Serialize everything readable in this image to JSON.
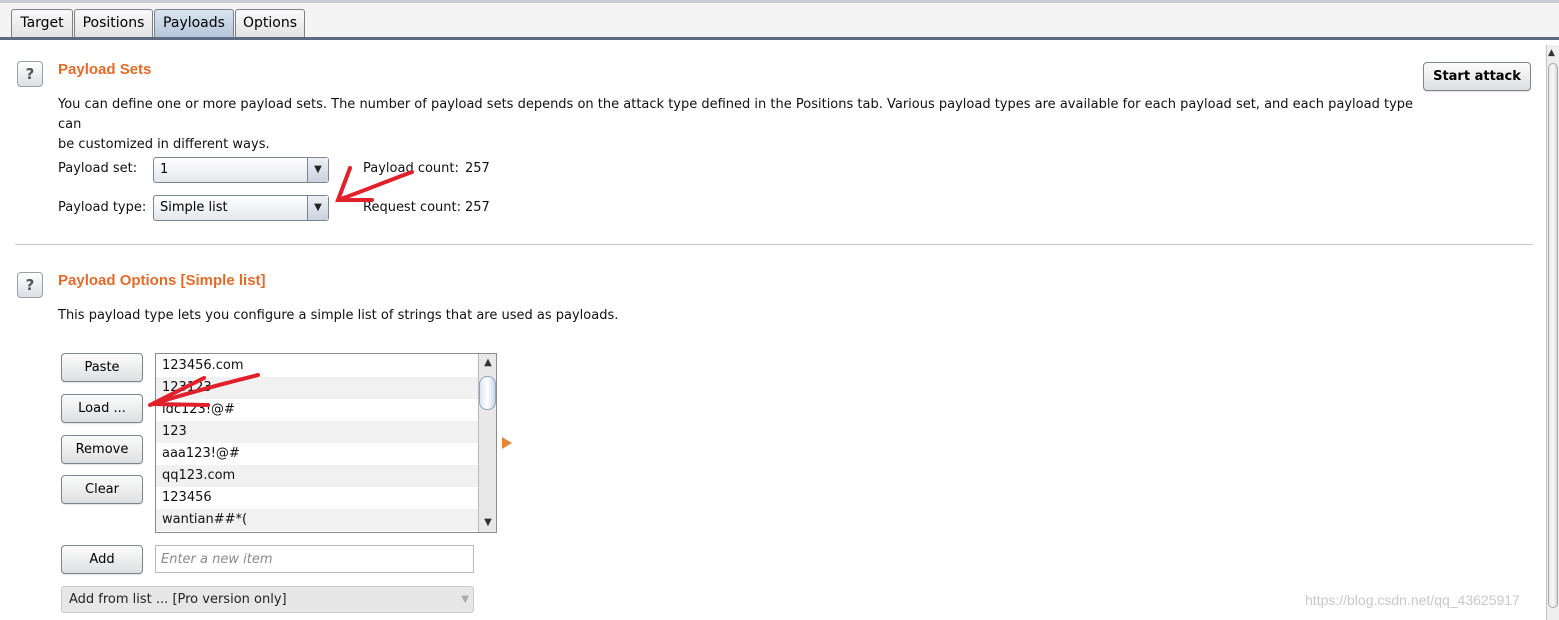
{
  "tabs": [
    {
      "label": "Target",
      "active": false
    },
    {
      "label": "Positions",
      "active": false
    },
    {
      "label": "Payloads",
      "active": true
    },
    {
      "label": "Options",
      "active": false
    }
  ],
  "payload_sets": {
    "title": "Payload Sets",
    "description_line1": "You can define one or more payload sets. The number of payload sets depends on the attack type defined in the Positions tab. Various payload types are available for each payload set, and each payload type can",
    "description_line2": "be customized in different ways.",
    "start_attack_label": "Start attack",
    "payload_set_label": "Payload set:",
    "payload_set_value": "1",
    "payload_type_label": "Payload type:",
    "payload_type_value": "Simple list",
    "payload_count_label": "Payload count:",
    "payload_count_value": "257",
    "request_count_label": "Request count:",
    "request_count_value": "257"
  },
  "payload_options": {
    "title": "Payload Options [Simple list]",
    "description": "This payload type lets you configure a simple list of strings that are used as payloads.",
    "buttons": {
      "paste": "Paste",
      "load": "Load ...",
      "remove": "Remove",
      "clear": "Clear",
      "add": "Add"
    },
    "list_items": [
      "123456.com",
      "123123",
      "ldc123!@#",
      "123",
      "aaa123!@#",
      "qq123.com",
      "123456",
      "wantian##*("
    ],
    "new_item_placeholder": "Enter a new item",
    "add_from_list_label": "Add from list ... [Pro version only]"
  },
  "icons": {
    "help": "?",
    "dropdown": "▼",
    "scroll_up": "▲",
    "scroll_down": "▼"
  },
  "colors": {
    "section_title": "#e36b2b",
    "annotation_red": "#e0202a",
    "tab_active": "#b6c6da"
  },
  "watermark": "https://blog.csdn.net/qq_43625917"
}
